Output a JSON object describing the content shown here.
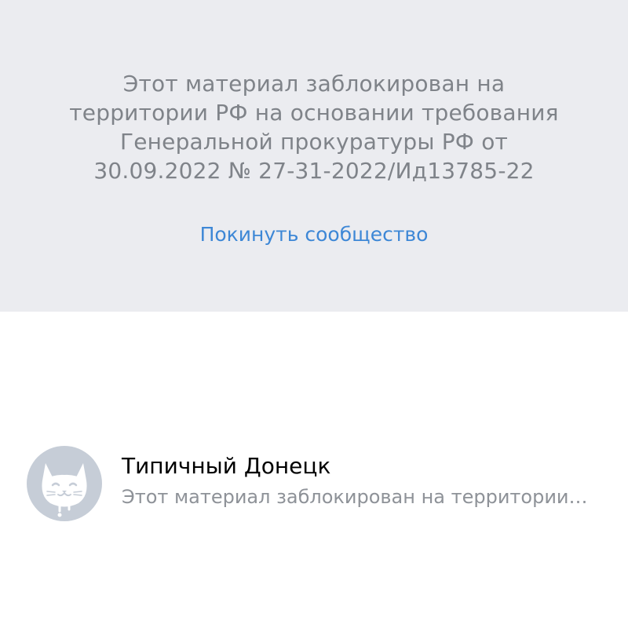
{
  "blocked_notice": {
    "lines": [
      "Этот материал заблокирован на",
      "территории РФ на основании требования",
      "Генеральной прокуратуры РФ от",
      "30.09.2022 № 27-31-2022/Ид13785-22"
    ],
    "leave_link_label": "Покинуть сообщество"
  },
  "chat": {
    "title": "Типичный Донецк",
    "preview": "Этот материал заблокирован на территории…",
    "avatar_icon": "cat-face-icon"
  },
  "colors": {
    "panel_background": "#ebecf0",
    "notice_text": "#7f8389",
    "link": "#3d87d6",
    "avatar_background": "#c6cdd7",
    "preview_text": "#8e9298"
  }
}
